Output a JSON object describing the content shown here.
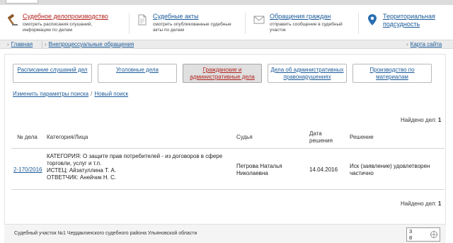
{
  "topnav": {
    "items": [
      {
        "title": "Судебное делопроизводство",
        "subtitle": "смотреть расписания слушаний, информацию по делам",
        "icon": "gavel-icon"
      },
      {
        "title": "Судебные акты",
        "subtitle": "смотреть опубликованные судебные акты по делам",
        "icon": "document-icon"
      },
      {
        "title": "Обращения граждан",
        "subtitle": "отправить сообщение в судебный участок",
        "icon": "envelope-icon"
      },
      {
        "title": "Территориальная подсудность",
        "subtitle": "",
        "icon": "map-pin-icon"
      }
    ]
  },
  "breadcrumb": {
    "home": "Главная",
    "current": "Внепроцессуальные обращения",
    "sitemap": "Карта сайта"
  },
  "tabs": [
    {
      "label": "Расписание слушаний дел"
    },
    {
      "label": "Уголовные дела"
    },
    {
      "label": "Гражданские и административные дела"
    },
    {
      "label": "Дела об административных правонарушениях"
    },
    {
      "label": "Производство по материалам"
    }
  ],
  "search": {
    "change_params": "Изменить параметры поиска",
    "separator": "/",
    "new_search": "Новый поиск"
  },
  "results": {
    "found_label": "Найдено дел:",
    "found_count": "1",
    "columns": {
      "number": "№ дела",
      "category": "Категория/Лица",
      "judge": "Судья",
      "date": "Дата решения",
      "decision": "Решение"
    },
    "rows": [
      {
        "number": "2-170/2016",
        "category_line1": "КАТЕГОРИЯ: О защите прав потребителей - из договоров в сфере",
        "category_line2": "торговли, услуг и т.п.",
        "plaintiff": "ИСТЕЦ: Айзатуллина Т. А.",
        "defendant": "ОТВЕТЧИК: Анейчик Н. С.",
        "judge_line1": "Петрова Наталья",
        "judge_line2": "Николаевна",
        "date": "14.04.2016",
        "decision_line1": "Иск (заявление) удовлетворен",
        "decision_line2": "частично"
      }
    ]
  },
  "footer": {
    "text": "Судебный участок №1 Чердаклинского судебного района Ульяновской области",
    "counter_top": "3",
    "counter_bottom": "8"
  },
  "colors": {
    "link": "#1a5a99",
    "active_red": "#b3211d"
  }
}
